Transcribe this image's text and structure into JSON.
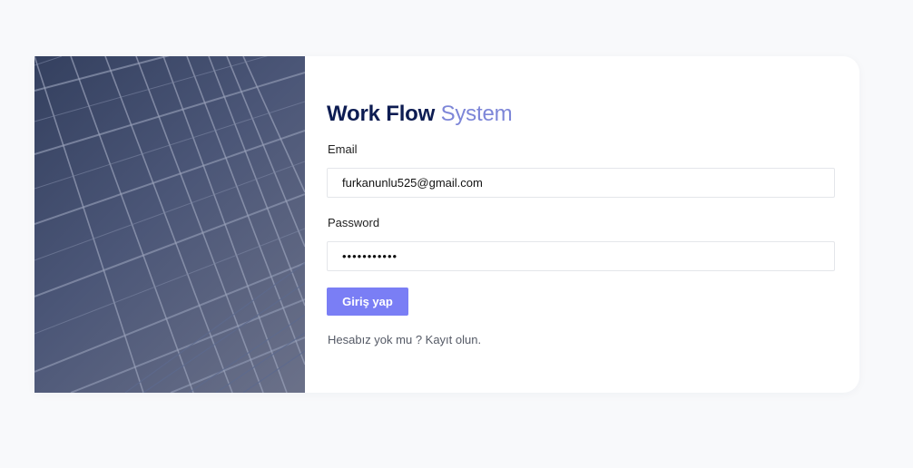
{
  "login": {
    "title_bold": "Work Flow",
    "title_light": "System",
    "email_label": "Email",
    "email_value": "furkanunlu525@gmail.com",
    "password_label": "Password",
    "password_masked": "•••••••••••",
    "submit_label": "Giriş yap",
    "register_text": "Hesabız yok mu ? Kayıt olun."
  },
  "colors": {
    "page_background": "#f8f9fb",
    "title_dark": "#0d1c52",
    "title_accent": "#7d86d8",
    "button": "#7a7ef5"
  },
  "icons": {
    "hero_image": "glass-building-facade"
  }
}
